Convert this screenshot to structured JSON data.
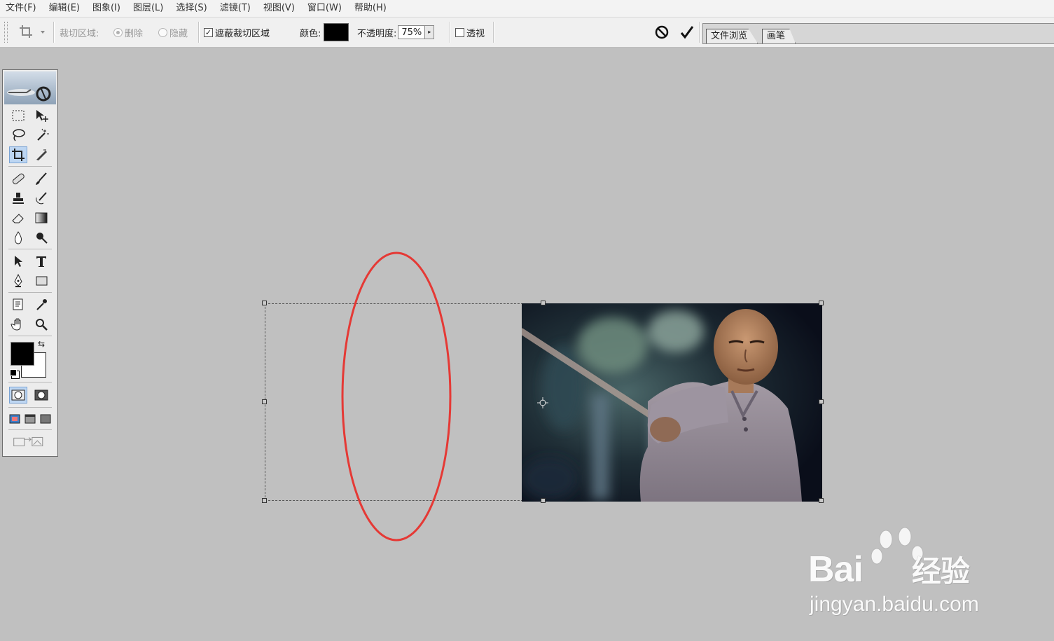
{
  "menu": [
    "文件(F)",
    "编辑(E)",
    "图象(I)",
    "图层(L)",
    "选择(S)",
    "滤镜(T)",
    "视图(V)",
    "窗口(W)",
    "帮助(H)"
  ],
  "options": {
    "crop_area_label": "裁切区域:",
    "delete_label": "删除",
    "hide_label": "隐藏",
    "shield_label": "遮蔽裁切区域",
    "shield_checked": true,
    "color_label": "颜色:",
    "shield_color": "#000000",
    "opacity_label": "不透明度:",
    "opacity_value": "75%",
    "perspective_label": "透视",
    "perspective_checked": false,
    "cancel_icon": "cancel-icon",
    "commit_icon": "commit-checkmark-icon"
  },
  "palette_well": {
    "tabs": [
      "文件浏览",
      "画笔"
    ]
  },
  "toolbox": {
    "foreground_color": "#000000",
    "background_color": "#ffffff",
    "active_tool": "crop-tool"
  },
  "annotation": {
    "ellipse_color": "#e53935"
  },
  "watermark": {
    "brand": "Bai",
    "brand_suffix": "经验",
    "url": "jingyan.baidu.com"
  }
}
